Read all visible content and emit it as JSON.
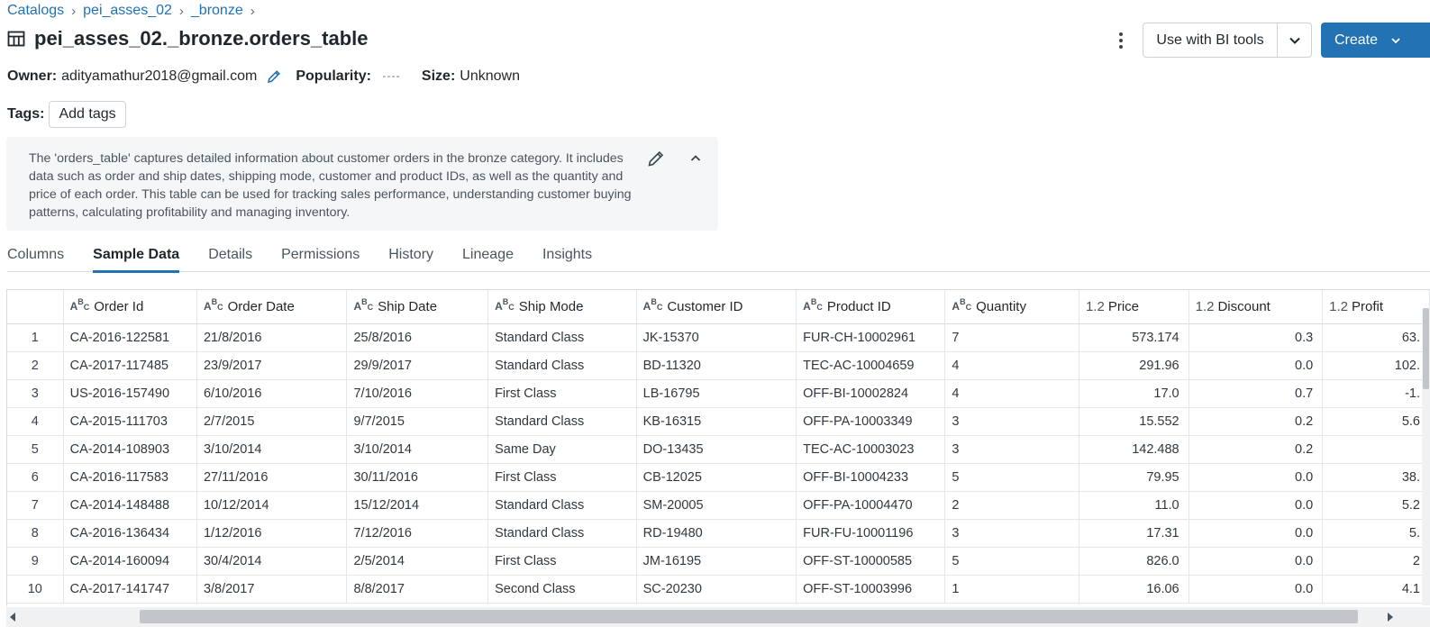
{
  "breadcrumb": {
    "items": [
      "Catalogs",
      "pei_asses_02",
      "_bronze"
    ],
    "separator": "›"
  },
  "page": {
    "title": "pei_asses_02._bronze.orders_table",
    "icon": "table-icon"
  },
  "toolbar": {
    "more_icon": "kebab-menu-icon",
    "bi_tools_label": "Use with BI tools",
    "create_label": "Create",
    "accent": "#2272b4"
  },
  "meta": {
    "owner_label": "Owner:",
    "owner_value": "adityamathur2018@gmail.com",
    "popularity_label": "Popularity:",
    "size_label": "Size:",
    "size_value": "Unknown"
  },
  "tags": {
    "label": "Tags:",
    "add_label": "Add tags"
  },
  "description": {
    "text": "The 'orders_table' captures detailed information about customer orders in the bronze category. It includes data such as order and ship dates, shipping mode, customer and product IDs, as well as the quantity and price of each order. This table can be used for tracking sales performance, understanding customer buying patterns, calculating profitability and managing inventory."
  },
  "tabs": [
    {
      "label": "Columns",
      "active": false
    },
    {
      "label": "Sample Data",
      "active": true
    },
    {
      "label": "Details",
      "active": false
    },
    {
      "label": "Permissions",
      "active": false
    },
    {
      "label": "History",
      "active": false
    },
    {
      "label": "Lineage",
      "active": false
    },
    {
      "label": "Insights",
      "active": false
    }
  ],
  "table": {
    "columns": [
      {
        "label": "Order Id",
        "type": "string"
      },
      {
        "label": "Order Date",
        "type": "string"
      },
      {
        "label": "Ship Date",
        "type": "string"
      },
      {
        "label": "Ship Mode",
        "type": "string"
      },
      {
        "label": "Customer ID",
        "type": "string"
      },
      {
        "label": "Product ID",
        "type": "string"
      },
      {
        "label": "Quantity",
        "type": "string"
      },
      {
        "label": "Price",
        "type": "number",
        "type_label": "1.2"
      },
      {
        "label": "Discount",
        "type": "number",
        "type_label": "1.2"
      },
      {
        "label": "Profit",
        "type": "number",
        "type_label": "1.2"
      }
    ],
    "rows": [
      [
        "1",
        "CA-2016-122581",
        "21/8/2016",
        "25/8/2016",
        "Standard Class",
        "JK-15370",
        "FUR-CH-10002961",
        "7",
        "573.174",
        "0.3",
        "63."
      ],
      [
        "2",
        "CA-2017-117485",
        "23/9/2017",
        "29/9/2017",
        "Standard Class",
        "BD-11320",
        "TEC-AC-10004659",
        "4",
        "291.96",
        "0.0",
        "102."
      ],
      [
        "3",
        "US-2016-157490",
        "6/10/2016",
        "7/10/2016",
        "First Class",
        "LB-16795",
        "OFF-BI-10002824",
        "4",
        "17.0",
        "0.7",
        "-1."
      ],
      [
        "4",
        "CA-2015-111703",
        "2/7/2015",
        "9/7/2015",
        "Standard Class",
        "KB-16315",
        "OFF-PA-10003349",
        "3",
        "15.552",
        "0.2",
        "5.6"
      ],
      [
        "5",
        "CA-2014-108903",
        "3/10/2014",
        "3/10/2014",
        "Same Day",
        "DO-13435",
        "TEC-AC-10003023",
        "3",
        "142.488",
        "0.2",
        ""
      ],
      [
        "6",
        "CA-2016-117583",
        "27/11/2016",
        "30/11/2016",
        "First Class",
        "CB-12025",
        "OFF-BI-10004233",
        "5",
        "79.95",
        "0.0",
        "38."
      ],
      [
        "7",
        "CA-2014-148488",
        "10/12/2014",
        "15/12/2014",
        "Standard Class",
        "SM-20005",
        "OFF-PA-10004470",
        "2",
        "11.0",
        "0.0",
        "5.2"
      ],
      [
        "8",
        "CA-2016-136434",
        "1/12/2016",
        "7/12/2016",
        "Standard Class",
        "RD-19480",
        "FUR-FU-10001196",
        "3",
        "17.31",
        "0.0",
        "5."
      ],
      [
        "9",
        "CA-2014-160094",
        "30/4/2014",
        "2/5/2014",
        "First Class",
        "JM-16195",
        "OFF-ST-10000585",
        "5",
        "826.0",
        "0.0",
        "2"
      ],
      [
        "10",
        "CA-2017-141747",
        "3/8/2017",
        "8/8/2017",
        "Second Class",
        "SC-20230",
        "OFF-ST-10003996",
        "1",
        "16.06",
        "0.0",
        "4.1"
      ]
    ]
  }
}
